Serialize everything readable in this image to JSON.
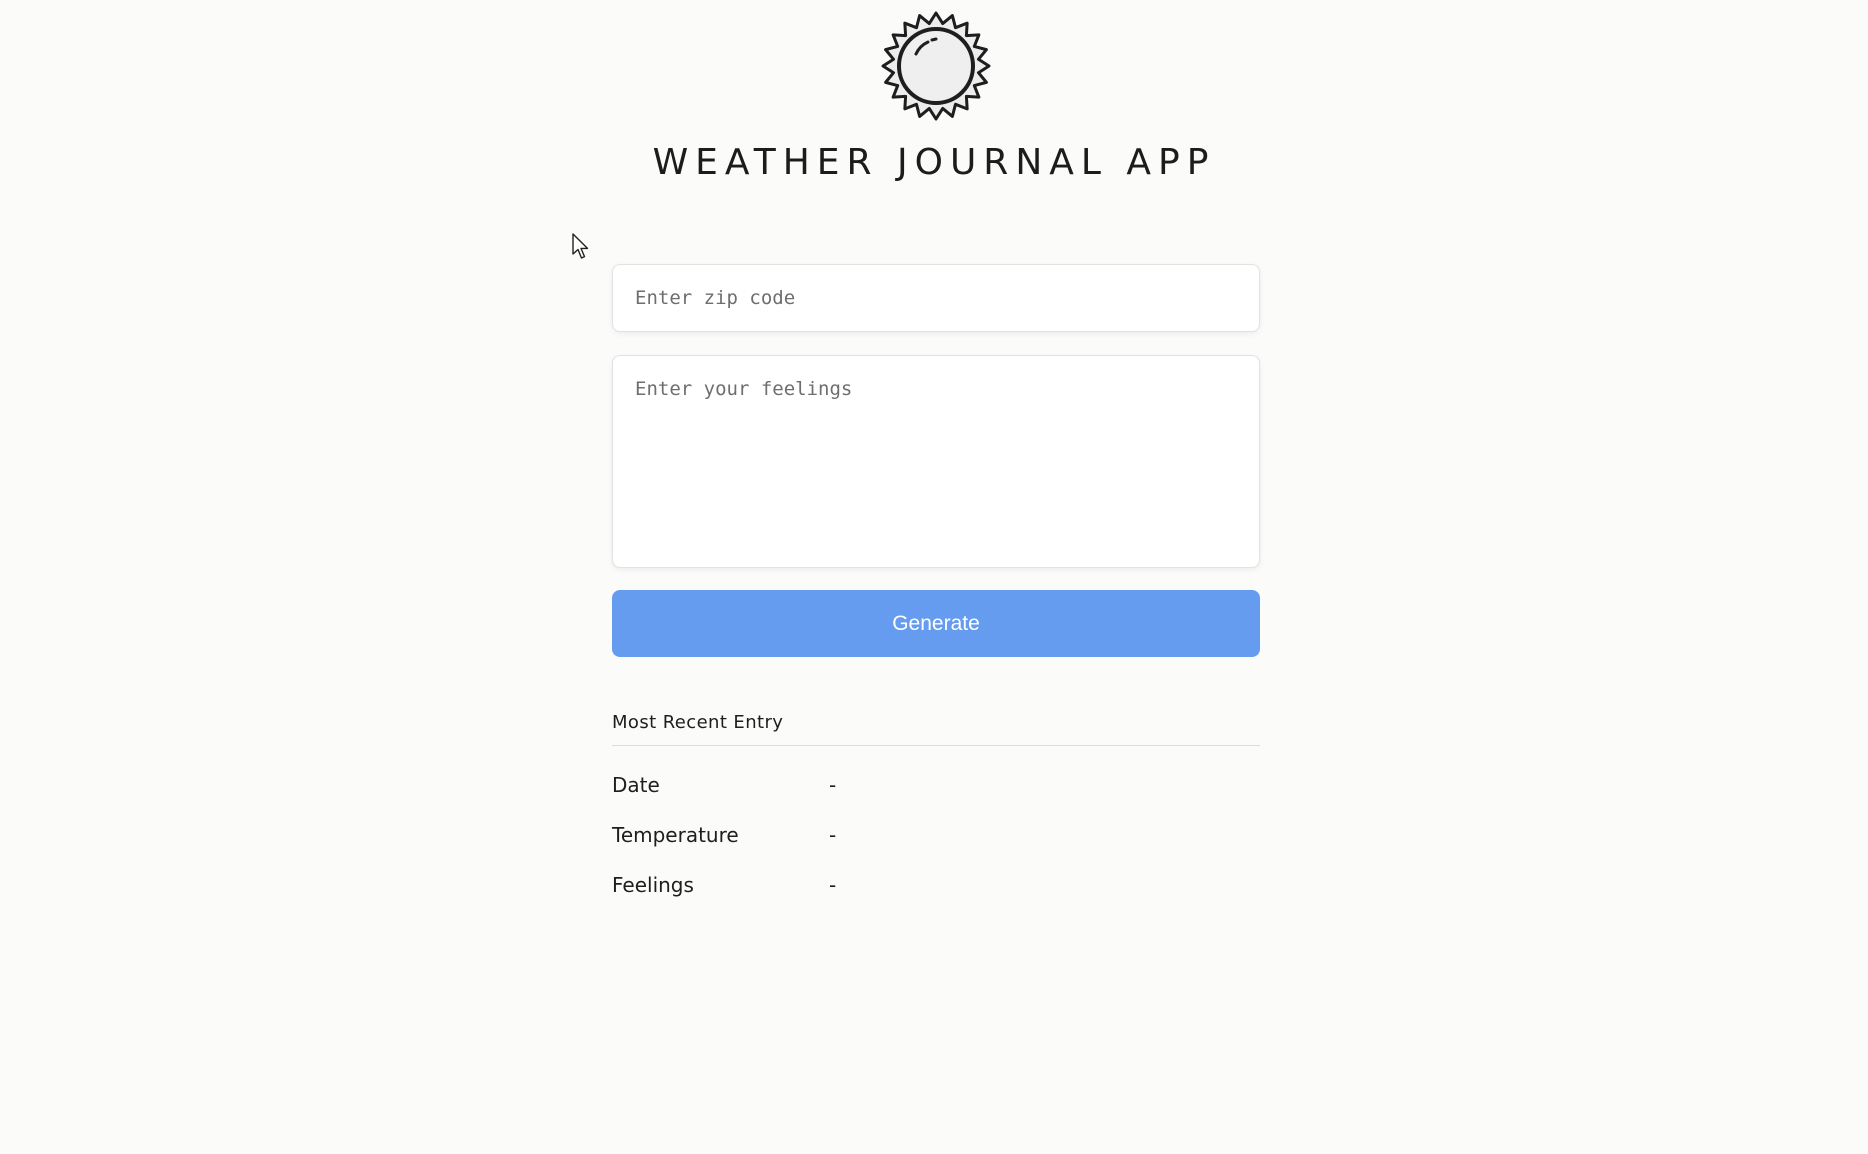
{
  "app": {
    "title": "WEATHER JOURNAL APP",
    "logo_icon": "sun-icon"
  },
  "form": {
    "zip_placeholder": "Enter zip code",
    "zip_value": "",
    "feelings_placeholder": "Enter your feelings",
    "feelings_value": "",
    "generate_label": "Generate"
  },
  "recent_entry": {
    "heading": "Most Recent Entry",
    "rows": [
      {
        "label": "Date",
        "value": "-"
      },
      {
        "label": "Temperature",
        "value": "-"
      },
      {
        "label": "Feelings",
        "value": "-"
      }
    ]
  },
  "colors": {
    "background": "#fbfbfa",
    "button": "#659cf0",
    "text": "#1e1e1e"
  }
}
